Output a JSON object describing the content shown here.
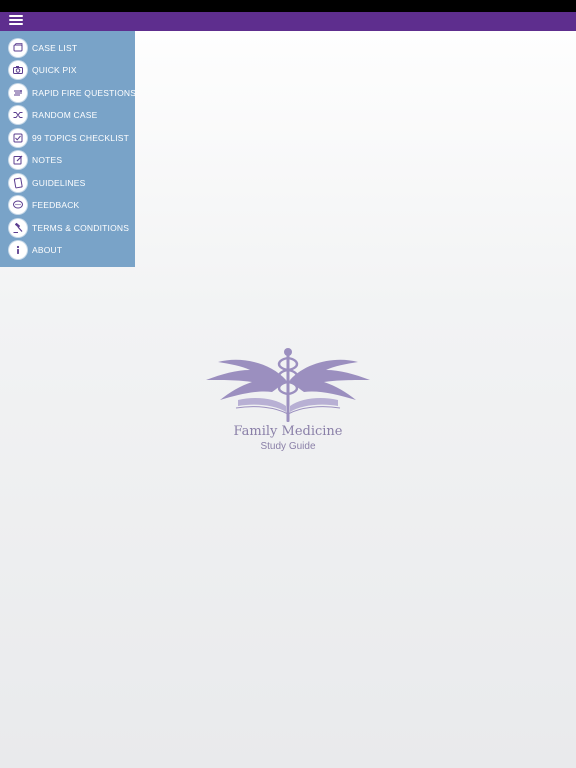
{
  "menu": {
    "items": [
      {
        "label": "CASE LIST",
        "icon": "case-list-icon"
      },
      {
        "label": "QUICK PIX",
        "icon": "camera-icon"
      },
      {
        "label": "RAPID FIRE QUESTIONS",
        "icon": "rapid-fire-icon"
      },
      {
        "label": "RANDOM CASE",
        "icon": "shuffle-icon"
      },
      {
        "label": "99 TOPICS CHECKLIST",
        "icon": "checklist-icon"
      },
      {
        "label": "NOTES",
        "icon": "notes-icon"
      },
      {
        "label": "GUIDELINES",
        "icon": "guidelines-icon"
      },
      {
        "label": "FEEDBACK",
        "icon": "feedback-icon"
      },
      {
        "label": "TERMS & CONDITIONS",
        "icon": "gavel-icon"
      },
      {
        "label": "ABOUT",
        "icon": "info-icon"
      }
    ]
  },
  "logo": {
    "title": "Family Medicine",
    "subtitle": "Study Guide"
  },
  "colors": {
    "nav_bar": "#5e2e8e",
    "menu_bg": "#79a3c8",
    "icon_purple": "#5b3d8f",
    "logo_purple": "#9b8fbf"
  }
}
